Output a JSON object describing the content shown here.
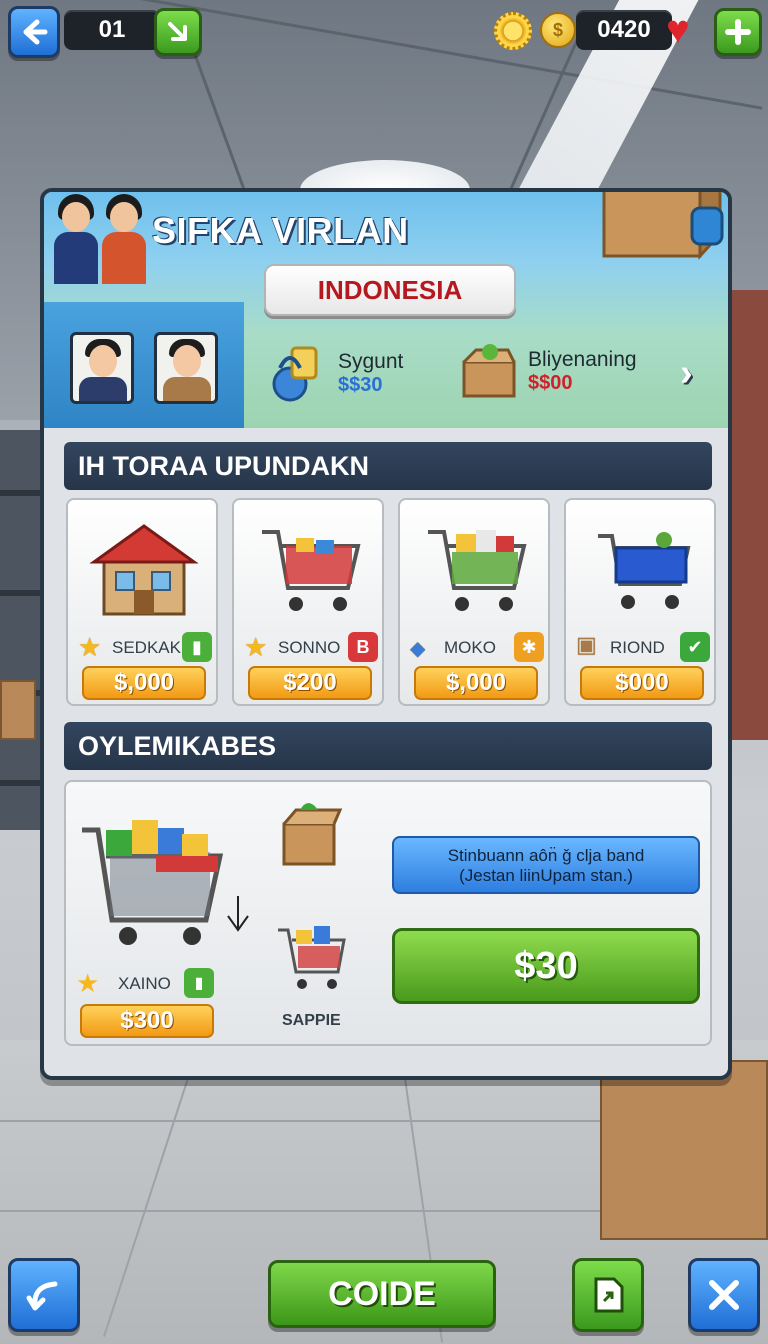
{
  "hud": {
    "level": "01",
    "coins": "0420"
  },
  "panel": {
    "title": "SIFKA VIRLAN",
    "country": "INDONESIA",
    "upgrades": [
      {
        "name": "Sygunt",
        "price": "$$30",
        "price_color": "#2b6fd6"
      },
      {
        "name": "Bliyenaning",
        "price": "$$00",
        "price_color": "#d0212a"
      }
    ]
  },
  "section1": {
    "title": "IH TORAA UPUNDAKN",
    "items": [
      {
        "name": "SEDKAK",
        "price": "$,000",
        "badge": "▮",
        "badge_color": "#4caf3a"
      },
      {
        "name": "SONNO",
        "price": "$200",
        "badge": "B",
        "badge_color": "#d9383a"
      },
      {
        "name": "MOKO",
        "price": "$,000",
        "badge": "✱",
        "badge_color": "#f0a020"
      },
      {
        "name": "RIOND",
        "price": "$000",
        "badge": "✔",
        "badge_color": "#3aa83a"
      }
    ]
  },
  "section2": {
    "title": "OYLEMIKABES",
    "main_item": {
      "name": "XAINO",
      "price": "$300"
    },
    "sample_label": "SAPPIE",
    "info_line1": "Stinbuann aôn̈ ǧ clja band",
    "info_line2": "(Jestan liinUpam stan.)",
    "buy_price": "$30"
  },
  "footer": {
    "center_label": "COIDE"
  },
  "colors": {
    "accent_blue": "#2d7ee0",
    "accent_green": "#4a9a1c",
    "price_orange": "#f29a14"
  }
}
